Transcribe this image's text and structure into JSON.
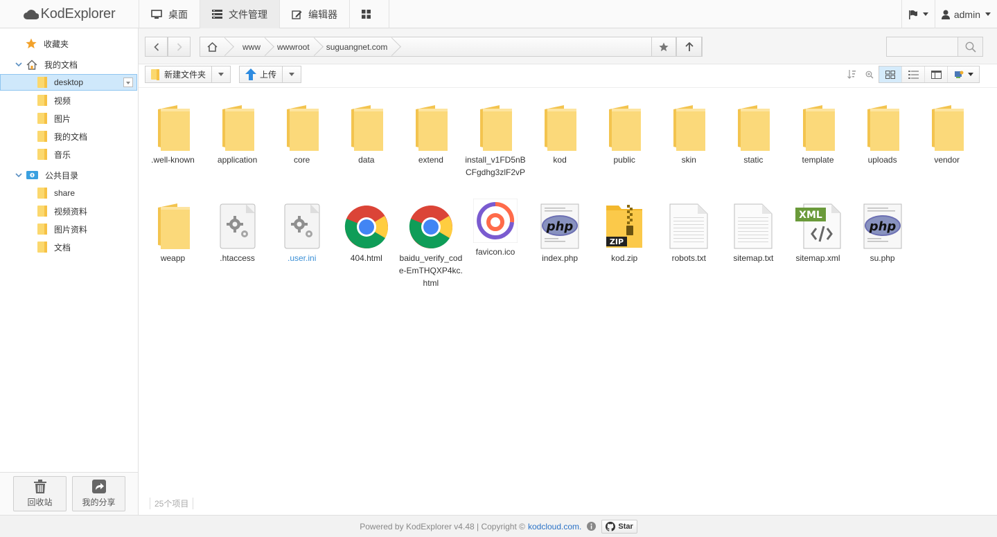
{
  "app": {
    "title": "KodExplorer"
  },
  "topnav": [
    {
      "label": "桌面",
      "icon": "desktop-icon"
    },
    {
      "label": "文件管理",
      "icon": "file-manager-icon",
      "active": true
    },
    {
      "label": "编辑器",
      "icon": "editor-icon"
    },
    {
      "label": "",
      "icon": "apps-grid-icon"
    }
  ],
  "user": {
    "name": "admin"
  },
  "sidebar": {
    "favorites": "收藏夹",
    "my_docs": "我的文档",
    "my_docs_children": [
      "desktop",
      "视频",
      "图片",
      "我的文档",
      "音乐"
    ],
    "public": "公共目录",
    "public_children": [
      "share",
      "视频资料",
      "图片资料",
      "文档"
    ],
    "recycle": "回收站",
    "share": "我的分享"
  },
  "path": {
    "crumbs": [
      "www",
      "wwwroot",
      "suguangnet.com"
    ]
  },
  "search": {
    "placeholder": ""
  },
  "toolbar": {
    "new_folder": "新建文件夹",
    "upload": "上传"
  },
  "files": [
    {
      "name": ".well-known",
      "type": "folder"
    },
    {
      "name": "application",
      "type": "folder"
    },
    {
      "name": "core",
      "type": "folder"
    },
    {
      "name": "data",
      "type": "folder"
    },
    {
      "name": "extend",
      "type": "folder"
    },
    {
      "name": "install_v1FD5nBCFgdhg3zlF2vP",
      "type": "folder"
    },
    {
      "name": "kod",
      "type": "folder"
    },
    {
      "name": "public",
      "type": "folder"
    },
    {
      "name": "skin",
      "type": "folder"
    },
    {
      "name": "static",
      "type": "folder"
    },
    {
      "name": "template",
      "type": "folder"
    },
    {
      "name": "uploads",
      "type": "folder"
    },
    {
      "name": "vendor",
      "type": "folder"
    },
    {
      "name": "weapp",
      "type": "folder"
    },
    {
      "name": ".htaccess",
      "type": "config"
    },
    {
      "name": ".user.ini",
      "type": "config",
      "hidden": true
    },
    {
      "name": "404.html",
      "type": "html"
    },
    {
      "name": "baidu_verify_code-EmTHQXP4kc.html",
      "type": "html"
    },
    {
      "name": "favicon.ico",
      "type": "ico"
    },
    {
      "name": "index.php",
      "type": "php"
    },
    {
      "name": "kod.zip",
      "type": "zip"
    },
    {
      "name": "robots.txt",
      "type": "txt"
    },
    {
      "name": "sitemap.txt",
      "type": "txt"
    },
    {
      "name": "sitemap.xml",
      "type": "xml"
    },
    {
      "name": "su.php",
      "type": "php"
    }
  ],
  "status": {
    "count": "25个项目"
  },
  "footer": {
    "text": "Powered by KodExplorer v4.48 | Copyright ©",
    "link": "kodcloud.com.",
    "star": "Star"
  },
  "colors": {
    "accent": "#2a72c6",
    "folder": "#fbd86e",
    "selection": "#cfe8fb"
  }
}
